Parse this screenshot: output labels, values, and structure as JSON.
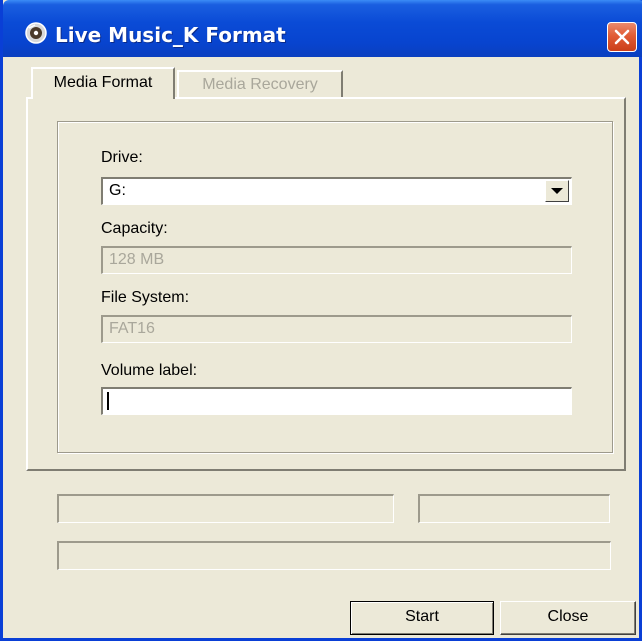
{
  "window": {
    "title": "Live Music_K Format",
    "titlebar_color": "#0a4bd6",
    "close_color": "#e15c35",
    "app_icon": "disc-icon",
    "close_icon": "close-icon"
  },
  "tabs": [
    {
      "label": "Media Format",
      "active": true
    },
    {
      "label": "Media Recovery",
      "active": false
    }
  ],
  "form": {
    "drive_label": "Drive:",
    "drive_value": "G:",
    "drive_dropdown_icon": "chevron-down-icon",
    "capacity_label": "Capacity:",
    "capacity_value": "128 MB",
    "filesystem_label": "File System:",
    "filesystem_value": "FAT16",
    "volume_label": "Volume label:",
    "volume_value": ""
  },
  "buttons": {
    "start": "Start",
    "close": "Close"
  }
}
